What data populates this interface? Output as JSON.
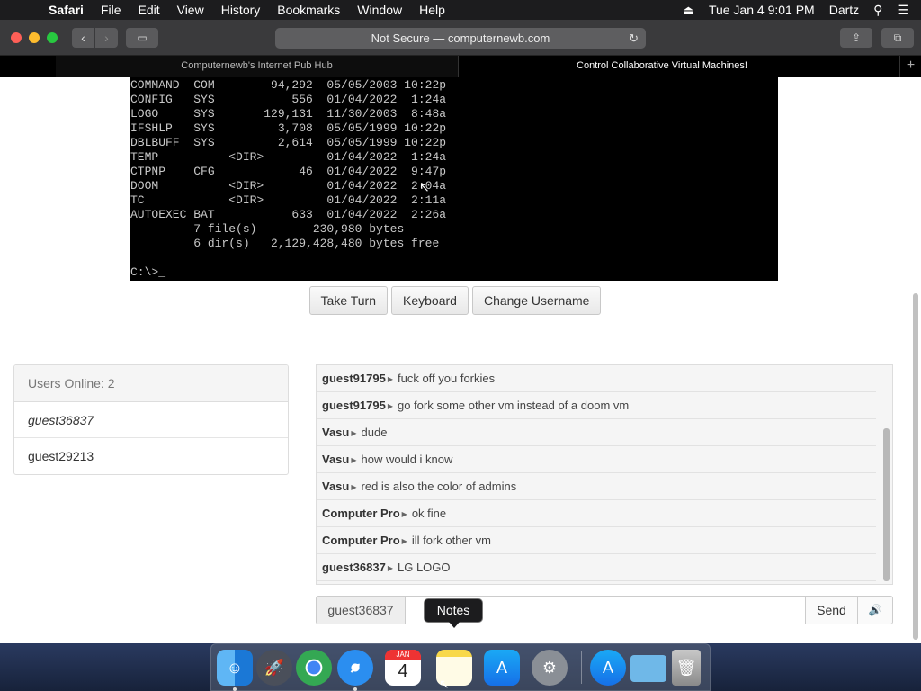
{
  "menubar": {
    "app": "Safari",
    "items": [
      "File",
      "Edit",
      "View",
      "History",
      "Bookmarks",
      "Window",
      "Help"
    ],
    "clock": "Tue Jan 4  9:01 PM",
    "user": "Dartz"
  },
  "browser": {
    "url": "Not Secure — computernewb.com",
    "tabs": [
      "Computernewb's Internet Pub Hub",
      "Control Collaborative Virtual Machines!"
    ]
  },
  "terminal": {
    "lines": [
      "COMMAND  COM        94,292  05/05/2003 10:22p",
      "CONFIG   SYS           556  01/04/2022  1:24a",
      "LOGO     SYS       129,131  11/30/2003  8:48a",
      "IFSHLP   SYS         3,708  05/05/1999 10:22p",
      "DBLBUFF  SYS         2,614  05/05/1999 10:22p",
      "TEMP          <DIR>         01/04/2022  1:24a",
      "CTPNP    CFG            46  01/04/2022  9:47p",
      "DOOM          <DIR>         01/04/2022  2:04a",
      "TC            <DIR>         01/04/2022  2:11a",
      "AUTOEXEC BAT           633  01/04/2022  2:26a",
      "         7 file(s)        230,980 bytes",
      "         6 dir(s)   2,129,428,480 bytes free",
      "",
      "C:\\>_"
    ]
  },
  "controls": {
    "take_turn": "Take Turn",
    "keyboard": "Keyboard",
    "change_username": "Change Username"
  },
  "users": {
    "header": "Users Online: 2",
    "list": [
      "guest36837",
      "guest29213"
    ]
  },
  "chat": {
    "messages": [
      {
        "user": "guest91795",
        "text": "fuck off you forkies"
      },
      {
        "user": "guest91795",
        "text": "go fork some other vm instead of a doom vm"
      },
      {
        "user": "Vasu",
        "text": "dude"
      },
      {
        "user": "Vasu",
        "text": "how would i know"
      },
      {
        "user": "Vasu",
        "text": "red is also the color of admins"
      },
      {
        "user": "Computer Pro",
        "text": "ok fine"
      },
      {
        "user": "Computer Pro",
        "text": "ill fork other vm"
      },
      {
        "user": "guest36837",
        "text": "LG LOGO"
      }
    ],
    "username": "guest36837",
    "send": "Send",
    "volume_icon": "🔊"
  },
  "dock": {
    "tooltip": "Notes",
    "calendar_month": "JAN",
    "calendar_day": "4"
  }
}
